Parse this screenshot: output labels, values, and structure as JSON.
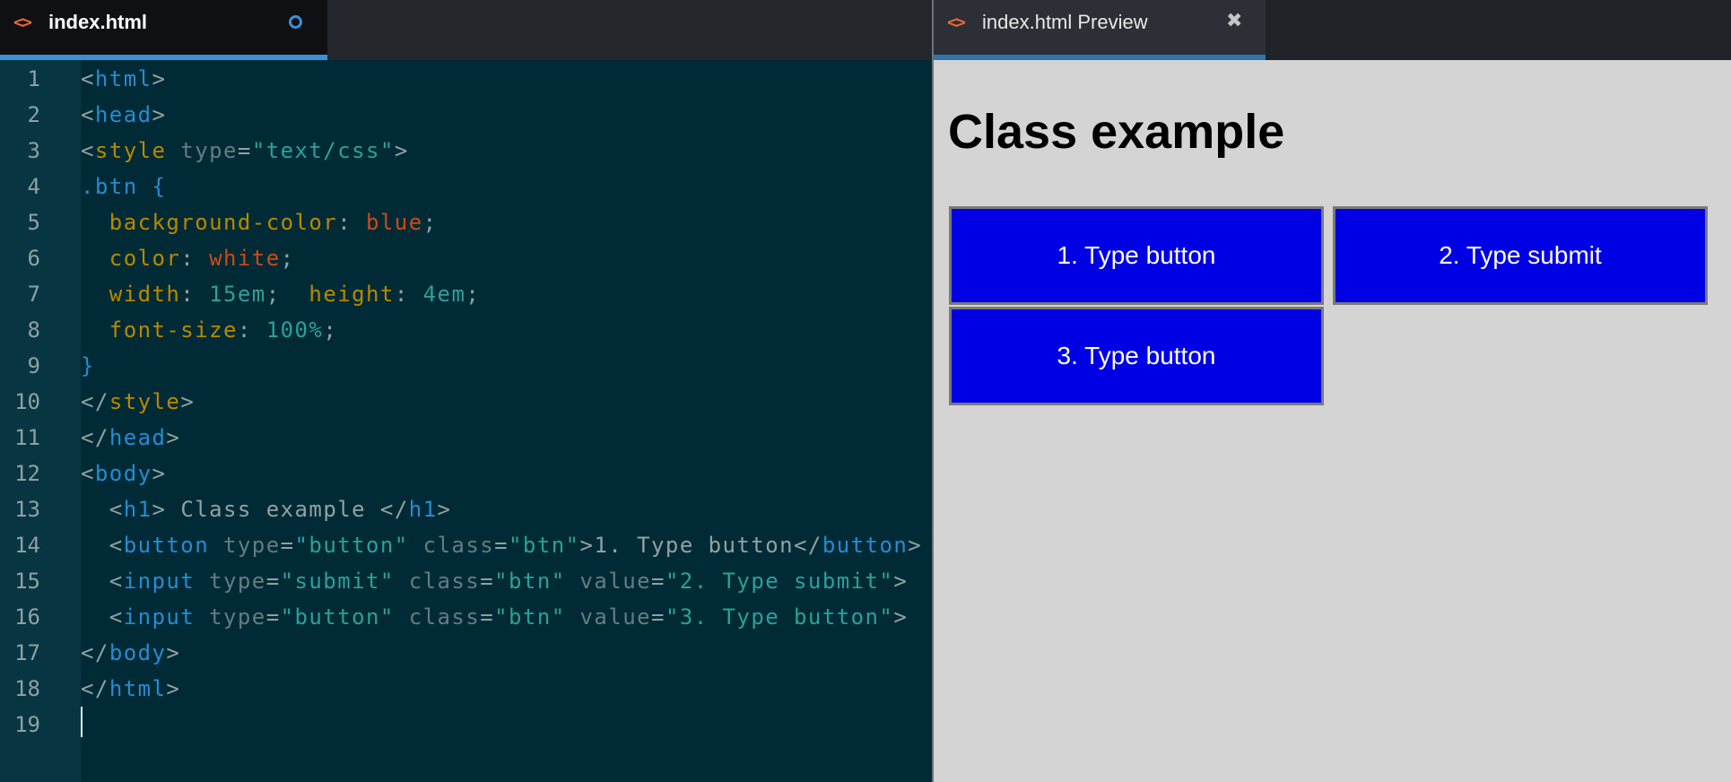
{
  "editor": {
    "tab_title": "index.html",
    "tab_icon": "code-brackets-icon",
    "line_numbers": [
      "1",
      "2",
      "3",
      "4",
      "5",
      "6",
      "7",
      "8",
      "9",
      "10",
      "11",
      "12",
      "13",
      "14",
      "15",
      "16",
      "17",
      "18",
      "19"
    ],
    "lines": [
      [
        [
          "<",
          "p"
        ],
        [
          "html",
          "t"
        ],
        [
          ">",
          "p"
        ]
      ],
      [
        [
          "<",
          "p"
        ],
        [
          "head",
          "t"
        ],
        [
          ">",
          "p"
        ]
      ],
      [
        [
          "<",
          "p"
        ],
        [
          "style",
          "y"
        ],
        [
          " type",
          "a"
        ],
        [
          "=",
          "p"
        ],
        [
          "\"text/css\"",
          "s"
        ],
        [
          ">",
          "p"
        ]
      ],
      [
        [
          ".btn {",
          "t"
        ]
      ],
      [
        [
          "  background-color",
          "y"
        ],
        [
          ": ",
          "p"
        ],
        [
          "blue",
          "o"
        ],
        [
          ";",
          "p"
        ]
      ],
      [
        [
          "  color",
          "y"
        ],
        [
          ": ",
          "p"
        ],
        [
          "white",
          "o"
        ],
        [
          ";",
          "p"
        ]
      ],
      [
        [
          "  width",
          "y"
        ],
        [
          ": ",
          "p"
        ],
        [
          "15em",
          "s"
        ],
        [
          ";  ",
          "p"
        ],
        [
          "height",
          "y"
        ],
        [
          ": ",
          "p"
        ],
        [
          "4em",
          "s"
        ],
        [
          ";",
          "p"
        ]
      ],
      [
        [
          "  font-size",
          "y"
        ],
        [
          ": ",
          "p"
        ],
        [
          "100%",
          "s"
        ],
        [
          ";",
          "p"
        ]
      ],
      [
        [
          "}",
          "t"
        ]
      ],
      [
        [
          "</",
          "p"
        ],
        [
          "style",
          "y"
        ],
        [
          ">",
          "p"
        ]
      ],
      [
        [
          "</",
          "p"
        ],
        [
          "head",
          "t"
        ],
        [
          ">",
          "p"
        ]
      ],
      [
        [
          "<",
          "p"
        ],
        [
          "body",
          "t"
        ],
        [
          ">",
          "p"
        ]
      ],
      [
        [
          "  <",
          "p"
        ],
        [
          "h1",
          "t"
        ],
        [
          ">",
          "p"
        ],
        [
          " Class example ",
          "x"
        ],
        [
          "</",
          "p"
        ],
        [
          "h1",
          "t"
        ],
        [
          ">",
          "p"
        ]
      ],
      [
        [
          "  <",
          "p"
        ],
        [
          "button",
          "t"
        ],
        [
          " type",
          "a"
        ],
        [
          "=",
          "p"
        ],
        [
          "\"button\"",
          "s"
        ],
        [
          " class",
          "a"
        ],
        [
          "=",
          "p"
        ],
        [
          "\"btn\"",
          "s"
        ],
        [
          ">",
          "p"
        ],
        [
          "1. Type button",
          "x"
        ],
        [
          "</",
          "p"
        ],
        [
          "button",
          "t"
        ],
        [
          ">",
          "p"
        ]
      ],
      [
        [
          "  <",
          "p"
        ],
        [
          "input",
          "t"
        ],
        [
          " type",
          "a"
        ],
        [
          "=",
          "p"
        ],
        [
          "\"submit\"",
          "s"
        ],
        [
          " class",
          "a"
        ],
        [
          "=",
          "p"
        ],
        [
          "\"btn\"",
          "s"
        ],
        [
          " value",
          "a"
        ],
        [
          "=",
          "p"
        ],
        [
          "\"2. Type submit\"",
          "s"
        ],
        [
          ">",
          "p"
        ]
      ],
      [
        [
          "  <",
          "p"
        ],
        [
          "input",
          "t"
        ],
        [
          " type",
          "a"
        ],
        [
          "=",
          "p"
        ],
        [
          "\"button\"",
          "s"
        ],
        [
          " class",
          "a"
        ],
        [
          "=",
          "p"
        ],
        [
          "\"btn\"",
          "s"
        ],
        [
          " value",
          "a"
        ],
        [
          "=",
          "p"
        ],
        [
          "\"3. Type button\"",
          "s"
        ],
        [
          ">",
          "p"
        ]
      ],
      [
        [
          "</",
          "p"
        ],
        [
          "body",
          "t"
        ],
        [
          ">",
          "p"
        ]
      ],
      [
        [
          "</",
          "p"
        ],
        [
          "html",
          "t"
        ],
        [
          ">",
          "p"
        ]
      ],
      []
    ]
  },
  "preview": {
    "tab_title": "index.html Preview",
    "tab_icon": "code-brackets-icon",
    "close_icon": "close-icon",
    "heading": "Class example",
    "buttons": [
      "1. Type button",
      "2. Type submit",
      "3. Type button"
    ]
  },
  "colors": {
    "editor_bg": "#002b36",
    "preview_bg": "#d3d4d3",
    "button_bg": "#0000e5",
    "tab_accent": "#3c8fd4"
  }
}
